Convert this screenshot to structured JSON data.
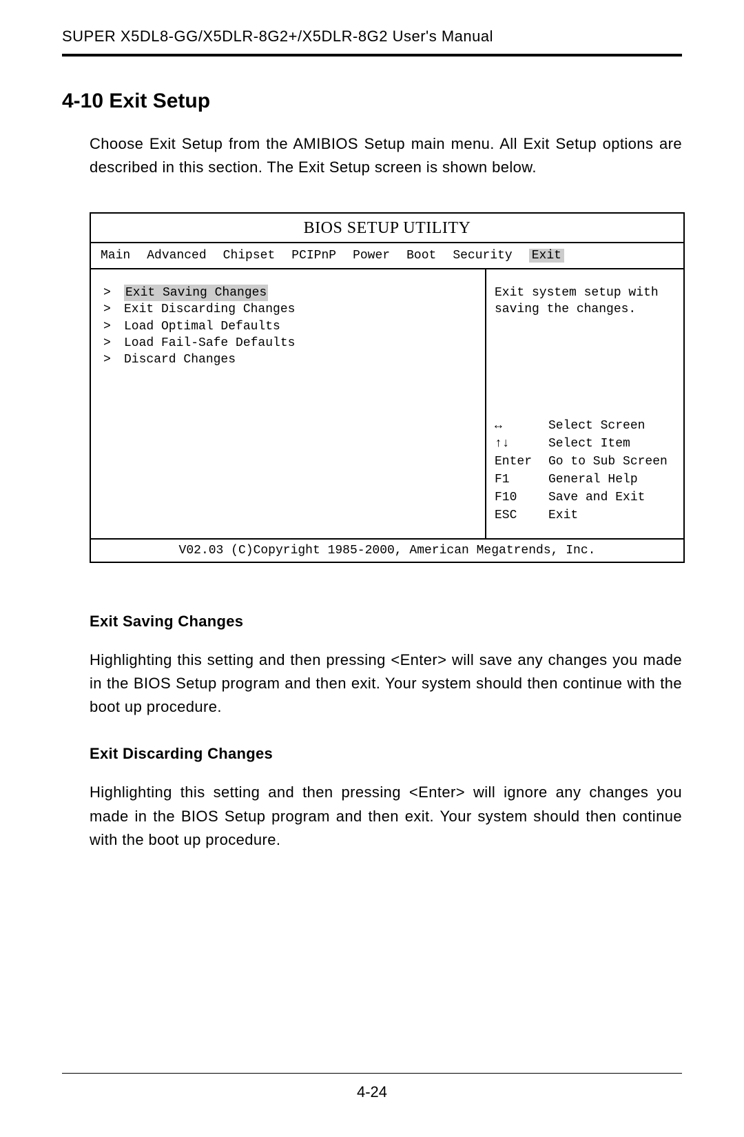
{
  "header": {
    "running_title": "SUPER X5DL8-GG/X5DLR-8G2+/X5DLR-8G2 User's Manual"
  },
  "section": {
    "number_title": "4-10  Exit Setup",
    "intro": "Choose Exit Setup from the AMIBIOS Setup main menu.  All Exit Setup options are described in this section.  The Exit Setup screen is shown below."
  },
  "bios": {
    "title": "BIOS SETUP UTILITY",
    "tabs": [
      "Main",
      "Advanced",
      "Chipset",
      "PCIPnP",
      "Power",
      "Boot",
      "Security",
      "Exit"
    ],
    "active_tab_index": 7,
    "menu_items": [
      {
        "marker": ">",
        "label": "Exit Saving Changes",
        "selected": true
      },
      {
        "marker": ">",
        "label": "Exit Discarding Changes",
        "selected": false
      },
      {
        "marker": ">",
        "label": "Load Optimal Defaults",
        "selected": false
      },
      {
        "marker": ">",
        "label": "Load Fail-Safe Defaults",
        "selected": false
      },
      {
        "marker": ">",
        "label": "Discard Changes",
        "selected": false
      }
    ],
    "help_text": "Exit system setup with saving the changes.",
    "keys": [
      {
        "k": "↔",
        "desc": "Select Screen"
      },
      {
        "k": "↑↓",
        "desc": "Select Item"
      },
      {
        "k": "Enter",
        "desc": "Go to Sub Screen"
      },
      {
        "k": "F1",
        "desc": "General Help"
      },
      {
        "k": "F10",
        "desc": "Save and Exit"
      },
      {
        "k": "ESC",
        "desc": "Exit"
      }
    ],
    "footer": "V02.03 (C)Copyright 1985-2000, American Megatrends, Inc."
  },
  "subsections": [
    {
      "heading": "Exit Saving Changes",
      "body": "Highlighting this setting and then pressing <Enter> will save any changes you made in the BIOS Setup program and then exit.  Your system should then continue with the boot up procedure."
    },
    {
      "heading": "Exit Discarding Changes",
      "body": "Highlighting this setting and then pressing <Enter> will ignore any changes you made in the BIOS Setup program and then exit.  Your system should then continue with the boot up procedure."
    }
  ],
  "page_number": "4-24"
}
